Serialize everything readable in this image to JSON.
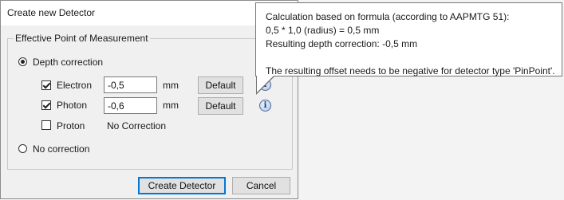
{
  "dialog": {
    "title": "Create new Detector",
    "group_title": "Effective Point of Measurement",
    "depth_correction_label": "Depth correction",
    "no_correction_label": "No correction",
    "rows": [
      {
        "label": "Electron",
        "value": "-0,5",
        "unit": "mm",
        "default_label": "Default",
        "checked": true
      },
      {
        "label": "Photon",
        "value": "-0,6",
        "unit": "mm",
        "default_label": "Default",
        "checked": true
      },
      {
        "label": "Proton",
        "static_value": "No Correction",
        "checked": false
      }
    ],
    "create_button": "Create Detector",
    "cancel_button": "Cancel"
  },
  "tooltip": {
    "line1": "Calculation based on formula (according to AAPMTG 51):",
    "line2": "0,5 * 1,0 (radius) = 0,5 mm",
    "line3": "Resulting depth correction: -0,5 mm",
    "line4": "",
    "line5": "The resulting offset needs to be negative for detector type 'PinPoint'."
  },
  "icons": {
    "info": "info-icon"
  }
}
